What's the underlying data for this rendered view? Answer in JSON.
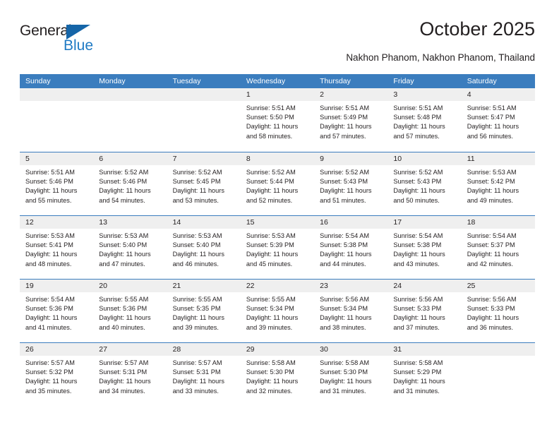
{
  "brand": {
    "name_top": "General",
    "name_bottom": "Blue",
    "triangle_icon": "blue-triangle-icon",
    "color_dark": "#231f20",
    "color_blue": "#1f7ac4"
  },
  "header": {
    "title": "October 2025",
    "subtitle": "Nakhon Phanom, Nakhon Phanom, Thailand"
  },
  "theme": {
    "header_blue": "#3b7dbe",
    "day_band_gray": "#efefef",
    "text": "#231f20"
  },
  "calendar": {
    "weekdays": [
      "Sunday",
      "Monday",
      "Tuesday",
      "Wednesday",
      "Thursday",
      "Friday",
      "Saturday"
    ],
    "weeks": [
      [
        {
          "day": "",
          "lines": []
        },
        {
          "day": "",
          "lines": []
        },
        {
          "day": "",
          "lines": []
        },
        {
          "day": "1",
          "lines": [
            "Sunrise: 5:51 AM",
            "Sunset: 5:50 PM",
            "Daylight: 11 hours",
            "and 58 minutes."
          ]
        },
        {
          "day": "2",
          "lines": [
            "Sunrise: 5:51 AM",
            "Sunset: 5:49 PM",
            "Daylight: 11 hours",
            "and 57 minutes."
          ]
        },
        {
          "day": "3",
          "lines": [
            "Sunrise: 5:51 AM",
            "Sunset: 5:48 PM",
            "Daylight: 11 hours",
            "and 57 minutes."
          ]
        },
        {
          "day": "4",
          "lines": [
            "Sunrise: 5:51 AM",
            "Sunset: 5:47 PM",
            "Daylight: 11 hours",
            "and 56 minutes."
          ]
        }
      ],
      [
        {
          "day": "5",
          "lines": [
            "Sunrise: 5:51 AM",
            "Sunset: 5:46 PM",
            "Daylight: 11 hours",
            "and 55 minutes."
          ]
        },
        {
          "day": "6",
          "lines": [
            "Sunrise: 5:52 AM",
            "Sunset: 5:46 PM",
            "Daylight: 11 hours",
            "and 54 minutes."
          ]
        },
        {
          "day": "7",
          "lines": [
            "Sunrise: 5:52 AM",
            "Sunset: 5:45 PM",
            "Daylight: 11 hours",
            "and 53 minutes."
          ]
        },
        {
          "day": "8",
          "lines": [
            "Sunrise: 5:52 AM",
            "Sunset: 5:44 PM",
            "Daylight: 11 hours",
            "and 52 minutes."
          ]
        },
        {
          "day": "9",
          "lines": [
            "Sunrise: 5:52 AM",
            "Sunset: 5:43 PM",
            "Daylight: 11 hours",
            "and 51 minutes."
          ]
        },
        {
          "day": "10",
          "lines": [
            "Sunrise: 5:52 AM",
            "Sunset: 5:43 PM",
            "Daylight: 11 hours",
            "and 50 minutes."
          ]
        },
        {
          "day": "11",
          "lines": [
            "Sunrise: 5:53 AM",
            "Sunset: 5:42 PM",
            "Daylight: 11 hours",
            "and 49 minutes."
          ]
        }
      ],
      [
        {
          "day": "12",
          "lines": [
            "Sunrise: 5:53 AM",
            "Sunset: 5:41 PM",
            "Daylight: 11 hours",
            "and 48 minutes."
          ]
        },
        {
          "day": "13",
          "lines": [
            "Sunrise: 5:53 AM",
            "Sunset: 5:40 PM",
            "Daylight: 11 hours",
            "and 47 minutes."
          ]
        },
        {
          "day": "14",
          "lines": [
            "Sunrise: 5:53 AM",
            "Sunset: 5:40 PM",
            "Daylight: 11 hours",
            "and 46 minutes."
          ]
        },
        {
          "day": "15",
          "lines": [
            "Sunrise: 5:53 AM",
            "Sunset: 5:39 PM",
            "Daylight: 11 hours",
            "and 45 minutes."
          ]
        },
        {
          "day": "16",
          "lines": [
            "Sunrise: 5:54 AM",
            "Sunset: 5:38 PM",
            "Daylight: 11 hours",
            "and 44 minutes."
          ]
        },
        {
          "day": "17",
          "lines": [
            "Sunrise: 5:54 AM",
            "Sunset: 5:38 PM",
            "Daylight: 11 hours",
            "and 43 minutes."
          ]
        },
        {
          "day": "18",
          "lines": [
            "Sunrise: 5:54 AM",
            "Sunset: 5:37 PM",
            "Daylight: 11 hours",
            "and 42 minutes."
          ]
        }
      ],
      [
        {
          "day": "19",
          "lines": [
            "Sunrise: 5:54 AM",
            "Sunset: 5:36 PM",
            "Daylight: 11 hours",
            "and 41 minutes."
          ]
        },
        {
          "day": "20",
          "lines": [
            "Sunrise: 5:55 AM",
            "Sunset: 5:36 PM",
            "Daylight: 11 hours",
            "and 40 minutes."
          ]
        },
        {
          "day": "21",
          "lines": [
            "Sunrise: 5:55 AM",
            "Sunset: 5:35 PM",
            "Daylight: 11 hours",
            "and 39 minutes."
          ]
        },
        {
          "day": "22",
          "lines": [
            "Sunrise: 5:55 AM",
            "Sunset: 5:34 PM",
            "Daylight: 11 hours",
            "and 39 minutes."
          ]
        },
        {
          "day": "23",
          "lines": [
            "Sunrise: 5:56 AM",
            "Sunset: 5:34 PM",
            "Daylight: 11 hours",
            "and 38 minutes."
          ]
        },
        {
          "day": "24",
          "lines": [
            "Sunrise: 5:56 AM",
            "Sunset: 5:33 PM",
            "Daylight: 11 hours",
            "and 37 minutes."
          ]
        },
        {
          "day": "25",
          "lines": [
            "Sunrise: 5:56 AM",
            "Sunset: 5:33 PM",
            "Daylight: 11 hours",
            "and 36 minutes."
          ]
        }
      ],
      [
        {
          "day": "26",
          "lines": [
            "Sunrise: 5:57 AM",
            "Sunset: 5:32 PM",
            "Daylight: 11 hours",
            "and 35 minutes."
          ]
        },
        {
          "day": "27",
          "lines": [
            "Sunrise: 5:57 AM",
            "Sunset: 5:31 PM",
            "Daylight: 11 hours",
            "and 34 minutes."
          ]
        },
        {
          "day": "28",
          "lines": [
            "Sunrise: 5:57 AM",
            "Sunset: 5:31 PM",
            "Daylight: 11 hours",
            "and 33 minutes."
          ]
        },
        {
          "day": "29",
          "lines": [
            "Sunrise: 5:58 AM",
            "Sunset: 5:30 PM",
            "Daylight: 11 hours",
            "and 32 minutes."
          ]
        },
        {
          "day": "30",
          "lines": [
            "Sunrise: 5:58 AM",
            "Sunset: 5:30 PM",
            "Daylight: 11 hours",
            "and 31 minutes."
          ]
        },
        {
          "day": "31",
          "lines": [
            "Sunrise: 5:58 AM",
            "Sunset: 5:29 PM",
            "Daylight: 11 hours",
            "and 31 minutes."
          ]
        },
        {
          "day": "",
          "lines": []
        }
      ]
    ]
  }
}
